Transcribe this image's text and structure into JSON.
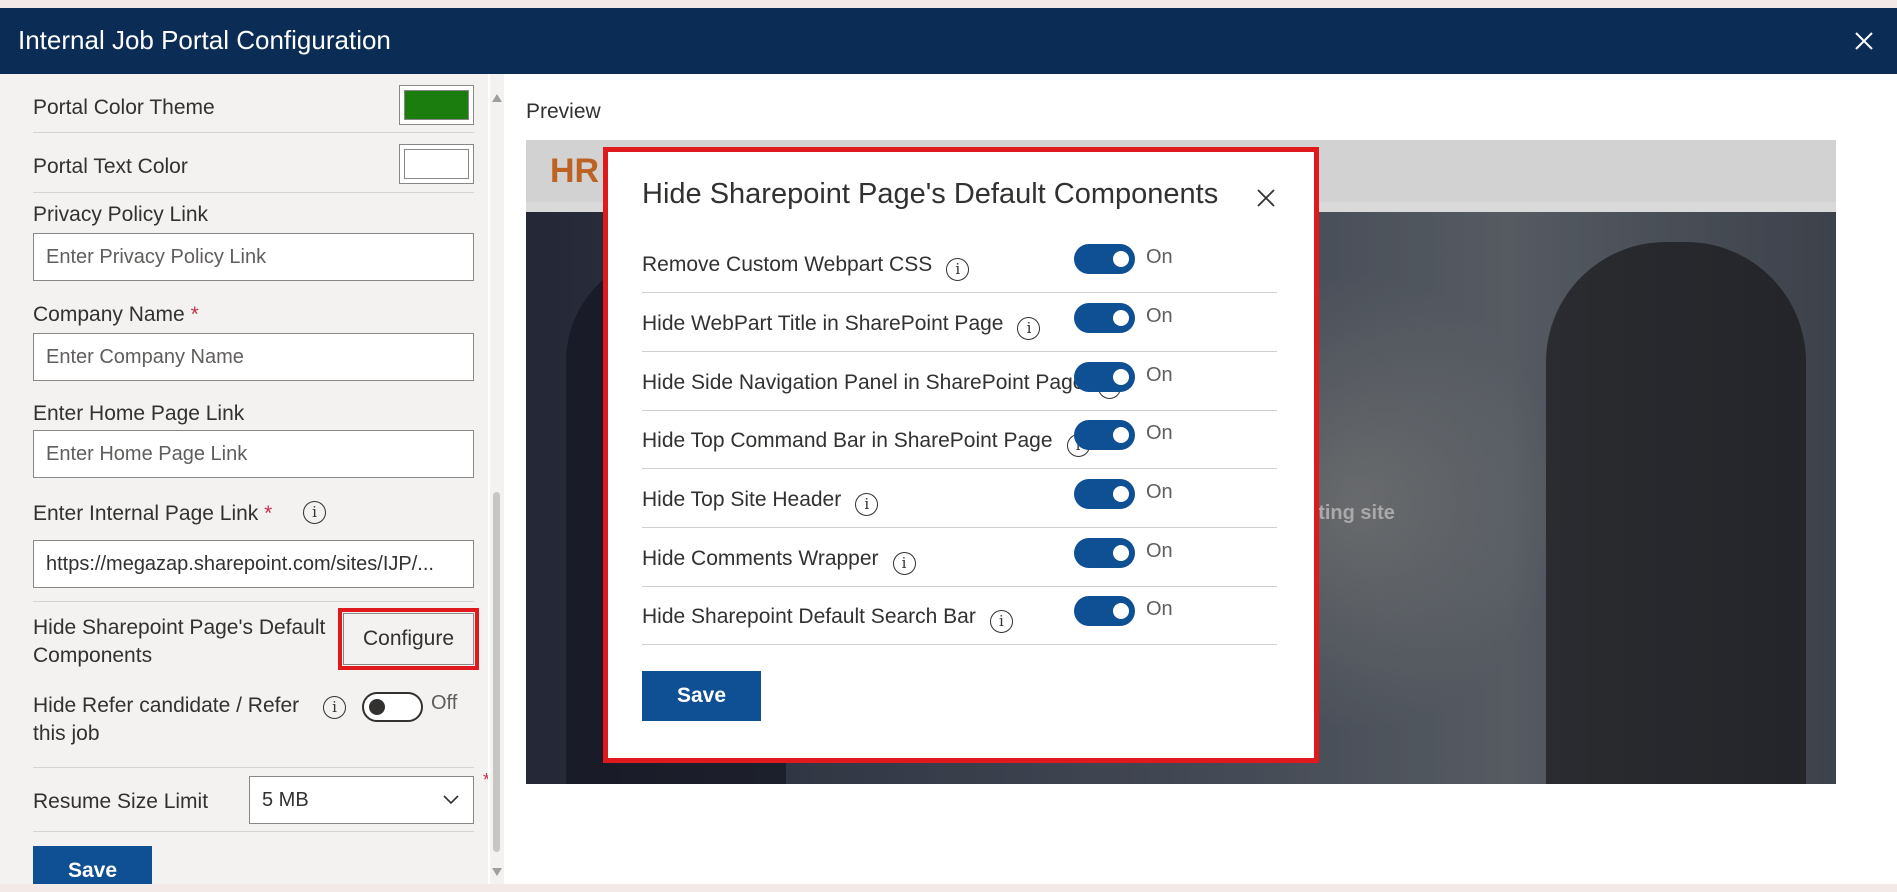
{
  "window": {
    "title": "Internal Job Portal Configuration",
    "close_icon": "close-icon"
  },
  "left": {
    "portal_color_theme": {
      "label": "Portal Color Theme",
      "color": "#1a7d0e"
    },
    "portal_text_color": {
      "label": "Portal Text Color",
      "color": "#ffffff"
    },
    "privacy_policy": {
      "label": "Privacy Policy Link",
      "placeholder": "Enter Privacy Policy Link"
    },
    "company_name": {
      "label": "Company Name",
      "required": "*",
      "placeholder": "Enter Company Name"
    },
    "home_page": {
      "label": "Enter Home Page Link",
      "placeholder": "Enter Home Page Link"
    },
    "internal_page": {
      "label": "Enter Internal Page Link",
      "required": "*",
      "value": "https://megazap.sharepoint.com/sites/IJP/..."
    },
    "hide_default": {
      "label": "Hide Sharepoint Page's Default Components",
      "button": "Configure"
    },
    "hide_refer": {
      "label": "Hide Refer candidate / Refer this job",
      "state": "Off"
    },
    "resume_size": {
      "label": "Resume Size Limit",
      "value": "5 MB",
      "required": "*"
    },
    "save": "Save"
  },
  "preview": {
    "label": "Preview",
    "logo": "HR",
    "hero_text": "nting site"
  },
  "dialog": {
    "title": "Hide Sharepoint Page's Default Components",
    "rows": [
      {
        "label": "Remove Custom Webpart CSS",
        "state": "On"
      },
      {
        "label": "Hide WebPart Title in SharePoint Page",
        "state": "On"
      },
      {
        "label": "Hide Side Navigation Panel in SharePoint Page",
        "state": "On"
      },
      {
        "label": "Hide Top Command Bar in SharePoint Page",
        "state": "On"
      },
      {
        "label": "Hide Top Site Header",
        "state": "On"
      },
      {
        "label": "Hide Comments Wrapper",
        "state": "On"
      },
      {
        "label": "Hide Sharepoint Default Search Bar",
        "state": "On"
      }
    ],
    "save": "Save"
  }
}
